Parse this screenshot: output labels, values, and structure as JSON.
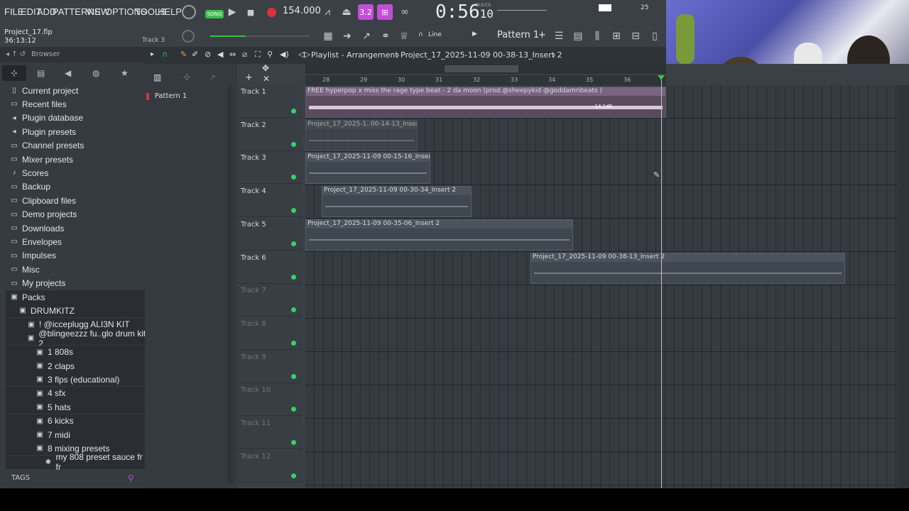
{
  "menu": [
    "FILE",
    "EDIT",
    "ADD",
    "PATTERNS",
    "VIEW",
    "OPTIONS",
    "TOOLS",
    "HELP"
  ],
  "transport": {
    "mode_label": "SONG",
    "tempo": "154.000",
    "time_main": "0:56",
    "time_sub": "10",
    "time_unit": "M:S:CS",
    "volume_value": "25"
  },
  "project": {
    "name": "Project_17.flp",
    "time": "36:13:12",
    "hint_track": "Track 3"
  },
  "toolbar2": {
    "snap": "Line",
    "pattern": "Pattern 1"
  },
  "browser": {
    "title": "Browser",
    "items": [
      {
        "label": "Current project",
        "icon": "page-icon"
      },
      {
        "label": "Recent files",
        "icon": "folder-icon"
      },
      {
        "label": "Plugin database",
        "icon": "plug-icon"
      },
      {
        "label": "Plugin presets",
        "icon": "plug-icon"
      },
      {
        "label": "Channel presets",
        "icon": "folder-icon"
      },
      {
        "label": "Mixer presets",
        "icon": "folder-icon"
      },
      {
        "label": "Scores",
        "icon": "note-icon"
      },
      {
        "label": "Backup",
        "icon": "folder-icon"
      },
      {
        "label": "Clipboard files",
        "icon": "folder-icon"
      },
      {
        "label": "Demo projects",
        "icon": "folder-icon"
      },
      {
        "label": "Downloads",
        "icon": "folder-icon"
      },
      {
        "label": "Envelopes",
        "icon": "folder-icon"
      },
      {
        "label": "Impulses",
        "icon": "folder-icon"
      },
      {
        "label": "Misc",
        "icon": "folder-icon"
      },
      {
        "label": "My projects",
        "icon": "folder-icon"
      },
      {
        "label": "Packs",
        "icon": "pack-icon"
      },
      {
        "label": "DRUMKITZ",
        "icon": "pack-icon"
      },
      {
        "label": "! @icceplugg ALI3N KIT",
        "icon": "pack-icon"
      },
      {
        "label": "@blingeezzz fu..glo drum kit 2",
        "icon": "pack-icon"
      },
      {
        "label": "1 808s",
        "icon": "pack-icon"
      },
      {
        "label": "2 claps",
        "icon": "pack-icon"
      },
      {
        "label": "3 flps (educational)",
        "icon": "pack-icon"
      },
      {
        "label": "4 sfx",
        "icon": "pack-icon"
      },
      {
        "label": "5 hats",
        "icon": "pack-icon"
      },
      {
        "label": "6 kicks",
        "icon": "pack-icon"
      },
      {
        "label": "7 midi",
        "icon": "pack-icon"
      },
      {
        "label": "8 mixing presets",
        "icon": "pack-icon"
      },
      {
        "label": "my 808 preset sauce fr fr",
        "icon": "preset-icon"
      }
    ],
    "tags_label": "TAGS"
  },
  "pattern_list": [
    "Pattern 1"
  ],
  "playlist": {
    "title": "Playlist - Arrangement",
    "breadcrumb": "Project_17_2025-11-09 00-38-13_Insert 2",
    "ruler": [
      "28",
      "29",
      "30",
      "31",
      "32",
      "33",
      "34",
      "35",
      "36"
    ],
    "tracks": [
      "Track 1",
      "Track 2",
      "Track 3",
      "Track 4",
      "Track 5",
      "Track 6",
      "Track 7",
      "Track 8",
      "Track 9",
      "Track 10",
      "Track 11",
      "Track 12"
    ],
    "clips": [
      {
        "title": "FREE hyperpop x miss the rage type beat - 2 da moon (prod.@sheepykid @goddamnbeats )",
        "gain": "-14.1dB"
      },
      {
        "title": "Project_17_2025-1..00-14-13_Insert 2"
      },
      {
        "title": "Project_17_2025-11-09 00-15-16_Insert 2"
      },
      {
        "title": "Project_17_2025-11-09 00-30-34_Insert 2"
      },
      {
        "title": "Project_17_2025-11-09 00-35-06_Insert 2"
      },
      {
        "title": "Project_17_2025-11-09 00-38-13_Insert 2"
      }
    ]
  },
  "colors": {
    "accent": "#c14fd6",
    "track_dot": "#37d167",
    "record": "#d8333b"
  }
}
